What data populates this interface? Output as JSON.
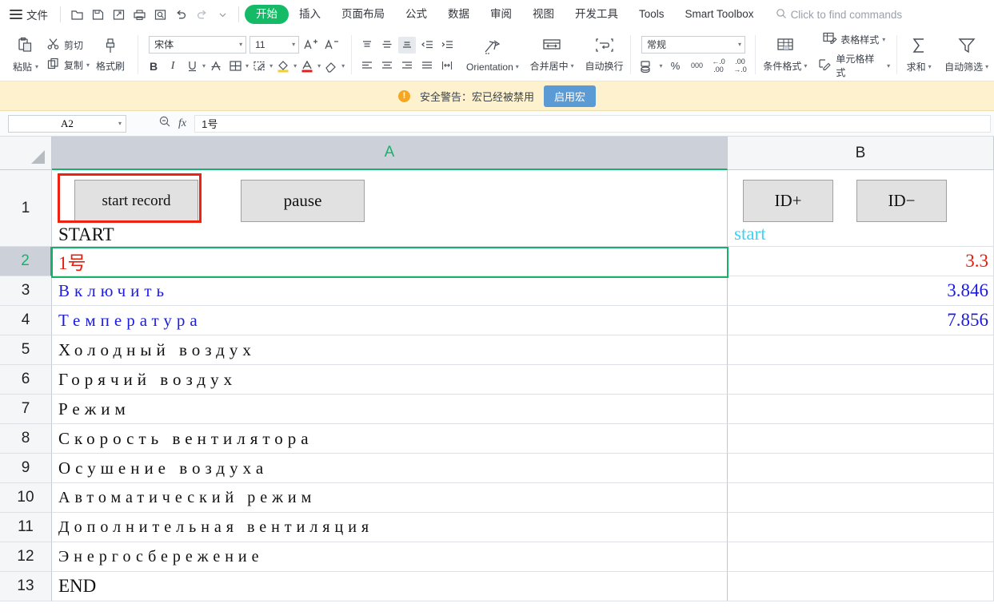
{
  "menubar": {
    "file_label": "文件",
    "quick_icons": [
      "open-icon",
      "save-icon",
      "save-as-icon",
      "print-icon",
      "print-preview-icon",
      "undo-icon",
      "redo-icon",
      "customize-caret-icon"
    ],
    "tabs": [
      {
        "label": "开始",
        "active": true
      },
      {
        "label": "插入",
        "active": false
      },
      {
        "label": "页面布局",
        "active": false
      },
      {
        "label": "公式",
        "active": false
      },
      {
        "label": "数据",
        "active": false
      },
      {
        "label": "审阅",
        "active": false
      },
      {
        "label": "视图",
        "active": false
      },
      {
        "label": "开发工具",
        "active": false
      },
      {
        "label": "Tools",
        "active": false
      },
      {
        "label": "Smart Toolbox",
        "active": false
      }
    ],
    "search_placeholder": "Click to find commands",
    "accent_color": "#15ba67"
  },
  "ribbon": {
    "clipboard": {
      "paste": "粘贴",
      "cut": "剪切",
      "copy": "复制",
      "format_painter": "格式刷"
    },
    "font": {
      "family": "宋体",
      "size": "11",
      "grow": "A",
      "shrink": "A",
      "bold": "B",
      "italic": "I",
      "underline": "U",
      "strike": "A",
      "border": "田",
      "effects": "effects-icon",
      "fill_color": "fill-color-icon",
      "font_color": "A",
      "clear": "clear-format-icon"
    },
    "alignment": {
      "orientation": "Orientation",
      "merge_center": "合并居中",
      "wrap_text": "自动换行"
    },
    "number": {
      "format": "常规",
      "accounting": "accounting-icon",
      "percent": "%",
      "comma": "000",
      "inc_decimal": ".00",
      "dec_decimal": ".00"
    },
    "styles": {
      "conditional": "条件格式",
      "table_style": "表格样式",
      "cell_style": "单元格样式"
    },
    "editing": {
      "autosum": "求和",
      "autofilter": "自动筛选"
    }
  },
  "warning": {
    "text": "安全警告：宏已经被禁用",
    "button": "启用宏",
    "icon": "warning-icon",
    "bg_color": "#fdf2cd",
    "button_color": "#5b9bd5"
  },
  "formula_bar": {
    "name_box": "A2",
    "zoom_icon": "zoom-out-icon",
    "fx": "fx",
    "value": "1号"
  },
  "sheet": {
    "columns": [
      {
        "label": "A",
        "selected": true
      },
      {
        "label": "B",
        "selected": false
      }
    ],
    "selected_cell": "A2",
    "selection_color": "#16b26b",
    "annotation_color": "#ee2211",
    "buttons": [
      {
        "label": "start record",
        "name": "start-record-button",
        "annotated": true
      },
      {
        "label": "pause",
        "name": "pause-button",
        "annotated": false
      },
      {
        "label": "ID+",
        "name": "id-increment-button",
        "annotated": false
      },
      {
        "label": "ID−",
        "name": "id-decrement-button",
        "annotated": false
      }
    ],
    "rows": [
      {
        "num": "1",
        "a": "START",
        "a_color": "#111111",
        "a_spaced": false,
        "b": "start",
        "b_color": "#3fd0f5",
        "selected": false
      },
      {
        "num": "2",
        "a": "1号",
        "a_color": "#e81b0c",
        "a_spaced": false,
        "b": "3.3",
        "b_color": "#e81b0c",
        "selected": true
      },
      {
        "num": "3",
        "a": "Включить",
        "a_color": "#1c1ce0",
        "a_spaced": true,
        "b": "3.846",
        "b_color": "#1c1ce0",
        "selected": false
      },
      {
        "num": "4",
        "a": "Температура",
        "a_color": "#1c1ce0",
        "a_spaced": true,
        "b": "7.856",
        "b_color": "#1c1ce0",
        "selected": false
      },
      {
        "num": "5",
        "a": "Холодный воздух",
        "a_color": "#111111",
        "a_spaced": true,
        "b": "",
        "b_color": "#111111",
        "selected": false
      },
      {
        "num": "6",
        "a": "Горячий воздух",
        "a_color": "#111111",
        "a_spaced": true,
        "b": "",
        "b_color": "#111111",
        "selected": false
      },
      {
        "num": "7",
        "a": "Режим",
        "a_color": "#111111",
        "a_spaced": true,
        "b": "",
        "b_color": "#111111",
        "selected": false
      },
      {
        "num": "8",
        "a": "Скорость вентилятора",
        "a_color": "#111111",
        "a_spaced": true,
        "b": "",
        "b_color": "#111111",
        "selected": false
      },
      {
        "num": "9",
        "a": "Осушение воздуха",
        "a_color": "#111111",
        "a_spaced": true,
        "b": "",
        "b_color": "#111111",
        "selected": false
      },
      {
        "num": "10",
        "a": "Автоматический режим",
        "a_color": "#111111",
        "a_spaced": true,
        "b": "",
        "b_color": "#111111",
        "selected": false
      },
      {
        "num": "11",
        "a": "Дополнительная вентиляция",
        "a_color": "#111111",
        "a_spaced": true,
        "b": "",
        "b_color": "#111111",
        "selected": false
      },
      {
        "num": "12",
        "a": "Энергосбережение",
        "a_color": "#111111",
        "a_spaced": true,
        "b": "",
        "b_color": "#111111",
        "selected": false
      },
      {
        "num": "13",
        "a": "END",
        "a_color": "#111111",
        "a_spaced": false,
        "b": "",
        "b_color": "#111111",
        "selected": false
      }
    ]
  }
}
